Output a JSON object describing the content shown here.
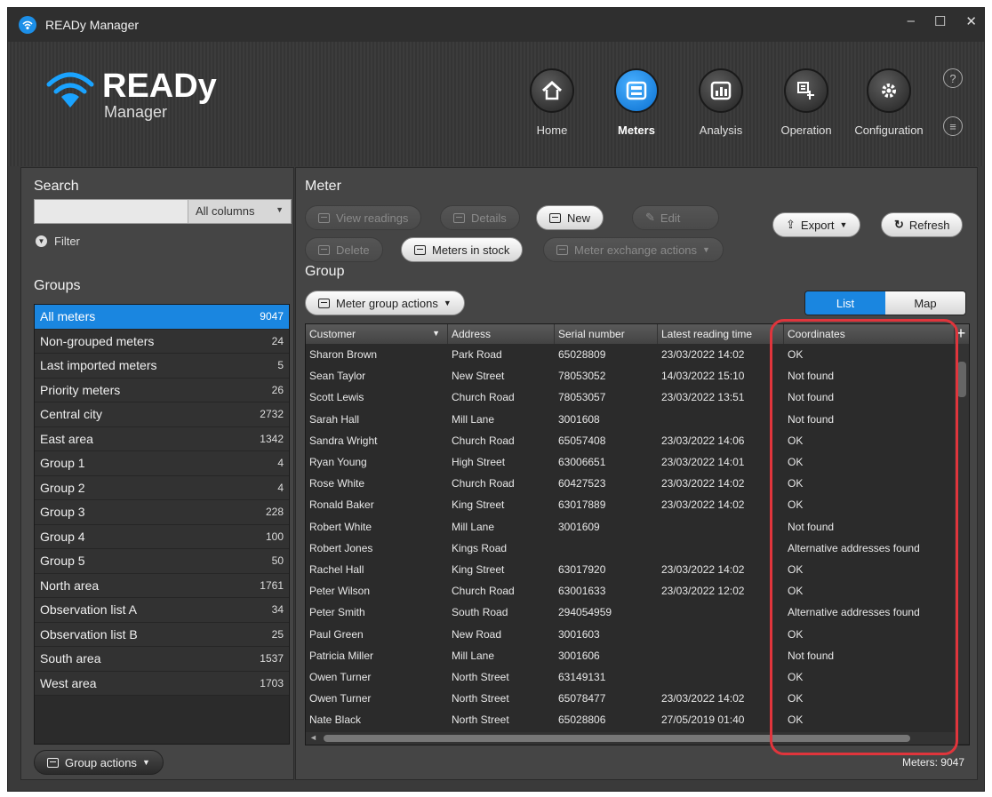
{
  "app": {
    "title": "READy Manager"
  },
  "window_controls": {
    "minimize": "–",
    "maximize": "☐",
    "close": "✕"
  },
  "logo": {
    "title": "READy",
    "subtitle": "Manager"
  },
  "nav": [
    {
      "label": "Home",
      "icon": "home-icon",
      "active": false
    },
    {
      "label": "Meters",
      "icon": "meter-icon",
      "active": true
    },
    {
      "label": "Analysis",
      "icon": "chart-icon",
      "active": false
    },
    {
      "label": "Operation",
      "icon": "operation-icon",
      "active": false
    },
    {
      "label": "Configuration",
      "icon": "gear-icon",
      "active": false
    }
  ],
  "help": {
    "help_glyph": "?",
    "options_glyph": "≡"
  },
  "search": {
    "title": "Search",
    "value": "",
    "column_select": "All columns",
    "filter_label": "Filter"
  },
  "groups": {
    "title": "Groups",
    "items": [
      {
        "name": "All meters",
        "count": "9047",
        "selected": true
      },
      {
        "name": "Non-grouped meters",
        "count": "24"
      },
      {
        "name": "Last imported meters",
        "count": "5"
      },
      {
        "name": "Priority meters",
        "count": "26"
      },
      {
        "name": "Central city",
        "count": "2732"
      },
      {
        "name": "East area",
        "count": "1342"
      },
      {
        "name": "Group 1",
        "count": "4"
      },
      {
        "name": "Group 2",
        "count": "4"
      },
      {
        "name": "Group 3",
        "count": "228"
      },
      {
        "name": "Group 4",
        "count": "100"
      },
      {
        "name": "Group 5",
        "count": "50"
      },
      {
        "name": "North area",
        "count": "1761"
      },
      {
        "name": "Observation list A",
        "count": "34"
      },
      {
        "name": "Observation list B",
        "count": "25"
      },
      {
        "name": "South area",
        "count": "1537"
      },
      {
        "name": "West area",
        "count": "1703"
      }
    ],
    "actions_label": "Group actions"
  },
  "meter": {
    "title": "Meter",
    "buttons": {
      "view_readings": "View readings",
      "details": "Details",
      "new": "New",
      "edit": "Edit",
      "delete": "Delete",
      "meters_in_stock": "Meters in stock",
      "exchange": "Meter exchange actions",
      "export": "Export",
      "refresh": "Refresh"
    }
  },
  "group_section": {
    "title": "Group",
    "actions_label": "Meter group actions",
    "view_toggle": {
      "list": "List",
      "map": "Map",
      "selected": "List"
    }
  },
  "table": {
    "columns": [
      "Customer",
      "Address",
      "Serial number",
      "Latest reading time",
      "Coordinates"
    ],
    "rows": [
      [
        "Sharon Brown",
        "Park Road",
        "65028809",
        "23/03/2022 14:02",
        "OK"
      ],
      [
        "Sean Taylor",
        "New Street",
        "78053052",
        "14/03/2022 15:10",
        "Not found"
      ],
      [
        "Scott Lewis",
        "Church Road",
        "78053057",
        "23/03/2022 13:51",
        "Not found"
      ],
      [
        "Sarah Hall",
        "Mill Lane",
        "3001608",
        "",
        "Not found"
      ],
      [
        "Sandra Wright",
        "Church Road",
        "65057408",
        "23/03/2022 14:06",
        "OK"
      ],
      [
        "Ryan Young",
        "High Street",
        "63006651",
        "23/03/2022 14:01",
        "OK"
      ],
      [
        "Rose White",
        "Church Road",
        "60427523",
        "23/03/2022 14:02",
        "OK"
      ],
      [
        "Ronald Baker",
        "King Street",
        "63017889",
        "23/03/2022 14:02",
        "OK"
      ],
      [
        "Robert White",
        "Mill Lane",
        "3001609",
        "",
        "Not found"
      ],
      [
        "Robert Jones",
        "Kings Road",
        "",
        "",
        "Alternative addresses found"
      ],
      [
        "Rachel Hall",
        "King Street",
        "63017920",
        "23/03/2022 14:02",
        "OK"
      ],
      [
        "Peter Wilson",
        "Church Road",
        "63001633",
        "23/03/2022 12:02",
        "OK"
      ],
      [
        "Peter Smith",
        "South Road",
        "294054959",
        "",
        "Alternative addresses found"
      ],
      [
        "Paul Green",
        "New Road",
        "3001603",
        "",
        "OK"
      ],
      [
        "Patricia Miller",
        "Mill Lane",
        "3001606",
        "",
        "Not found"
      ],
      [
        "Owen Turner",
        "North Street",
        "63149131",
        "",
        "OK"
      ],
      [
        "Owen Turner",
        "North Street",
        "65078477",
        "23/03/2022 14:02",
        "OK"
      ],
      [
        "Nate Black",
        "North Street",
        "65028806",
        "27/05/2019 01:40",
        "OK"
      ]
    ]
  },
  "status": {
    "meters_count": "Meters: 9047"
  },
  "colors": {
    "accent": "#1a86e0",
    "highlight": "#e0353c"
  }
}
